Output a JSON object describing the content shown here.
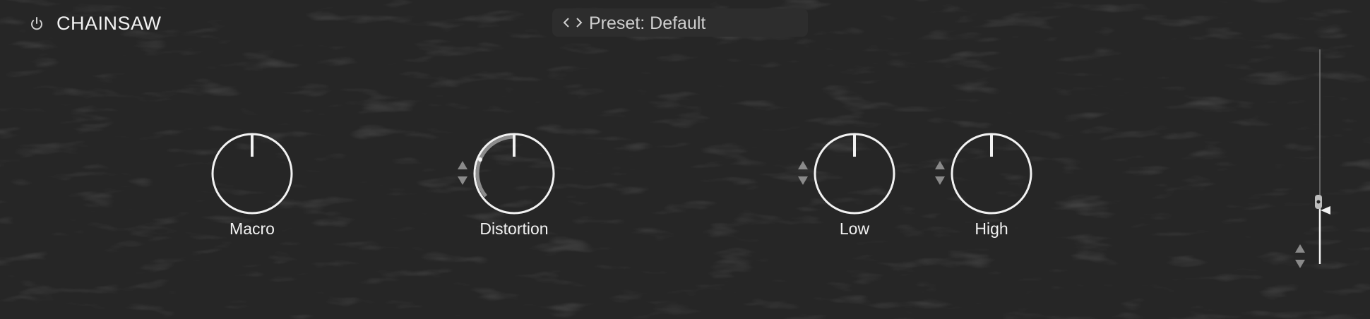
{
  "header": {
    "title": "CHAINSAW",
    "power_icon": "power-icon"
  },
  "preset": {
    "label": "Preset: Default",
    "prev_icon": "chevron-left-icon",
    "next_icon": "chevron-right-icon"
  },
  "knobs": [
    {
      "label": "Macro",
      "value": 0.5,
      "has_stepper": false
    },
    {
      "label": "Distortion",
      "value": 0.5,
      "modulation_range": 0.2,
      "has_stepper": true
    },
    {
      "label": "Low",
      "value": 0.5,
      "has_stepper": true
    },
    {
      "label": "High",
      "value": 0.5,
      "has_stepper": true
    }
  ],
  "output": {
    "level": 0.28,
    "has_stepper": true
  },
  "colors": {
    "background": "#262626",
    "foreground": "#f2f2f2",
    "muted": "#8a8a8a",
    "modulation": "#8c8c8c"
  }
}
